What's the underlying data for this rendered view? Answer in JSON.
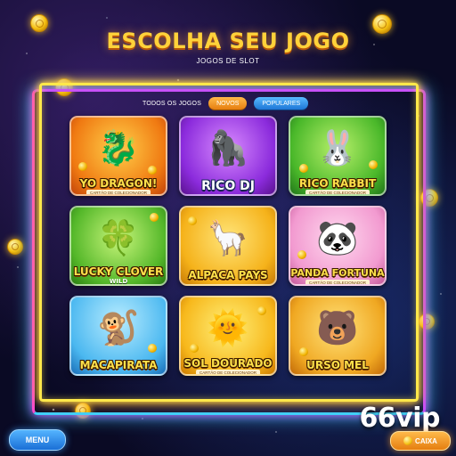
{
  "header": {
    "title": "ESCOLHA SEU JOGO",
    "subtitle": "JOGOS DE SLOT"
  },
  "filters": {
    "all_label": "TODOS OS JOGOS",
    "new_label": "NOVOS",
    "popular_label": "POPULARES"
  },
  "games": [
    {
      "name": "YO DRAGON!",
      "tag": "CARTÃO DE COLECIONADOR",
      "mascot": "dragon-icon",
      "glyph": "🐉"
    },
    {
      "name": "RICO DJ",
      "mascot": "gorilla-dj-icon",
      "glyph": "🦍"
    },
    {
      "name": "RICO RABBIT",
      "tag": "CARTÃO DE COLECIONADOR",
      "mascot": "rabbit-icon",
      "glyph": "🐰"
    },
    {
      "name": "LUCKY CLOVER",
      "sub": "WILD",
      "mascot": "clover-icon",
      "glyph": "🍀"
    },
    {
      "name": "ALPACA PAYS",
      "mascot": "alpaca-icon",
      "glyph": "🦙"
    },
    {
      "name": "PANDA FORTUNA",
      "tag": "CARTÃO DE COLECIONADOR",
      "mascot": "panda-icon",
      "glyph": "🐼"
    },
    {
      "name": "MACAPIRATA",
      "mascot": "pirate-monkey-icon",
      "glyph": "🐒"
    },
    {
      "name": "SOL DOURADO",
      "tag": "CARTÃO DE COLECIONADOR",
      "mascot": "sun-icon",
      "glyph": "🌞"
    },
    {
      "name": "URSO MEL",
      "mascot": "bear-icon",
      "glyph": "🐻"
    }
  ],
  "brand": "66vip",
  "footer": {
    "menu_label": "MENU",
    "caixa_label": "CAIXA"
  },
  "colors": {
    "title": "#ffd23a",
    "neon_yellow": "#ffe84a",
    "neon_purple": "#c64cff",
    "neon_cyan": "#3ad1ff",
    "chip_new": "#f29a22",
    "chip_popular": "#2a8ae6"
  }
}
